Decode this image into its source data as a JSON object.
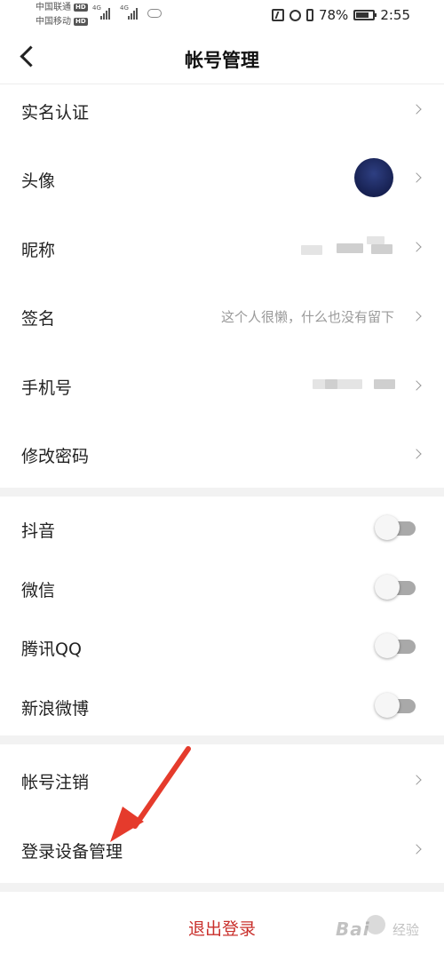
{
  "status_bar": {
    "carrier1": "中国联通",
    "carrier2": "中国移动",
    "hd_badge": "HD",
    "network1": "4G",
    "network2": "4G",
    "battery_text": "78%",
    "battery_level": 0.78,
    "time": "2:55"
  },
  "nav": {
    "title": "帐号管理"
  },
  "profile": [
    {
      "label": "实名认证"
    },
    {
      "label": "头像"
    },
    {
      "label": "昵称"
    },
    {
      "label": "签名",
      "value": "这个人很懒，什么也没有留下"
    },
    {
      "label": "手机号"
    },
    {
      "label": "修改密码"
    }
  ],
  "bindings": [
    {
      "label": "抖音",
      "enabled": false
    },
    {
      "label": "微信",
      "enabled": false
    },
    {
      "label": "腾讯QQ",
      "enabled": false
    },
    {
      "label": "新浪微博",
      "enabled": false
    }
  ],
  "account": [
    {
      "label": "帐号注销"
    },
    {
      "label": "登录设备管理"
    }
  ],
  "logout_label": "退出登录",
  "watermark": {
    "brand": "Bai",
    "brand2": "经验"
  },
  "colors": {
    "logout": "#c9302c",
    "annotation_arrow": "#e53b2c",
    "avatar": "#1a2558"
  }
}
